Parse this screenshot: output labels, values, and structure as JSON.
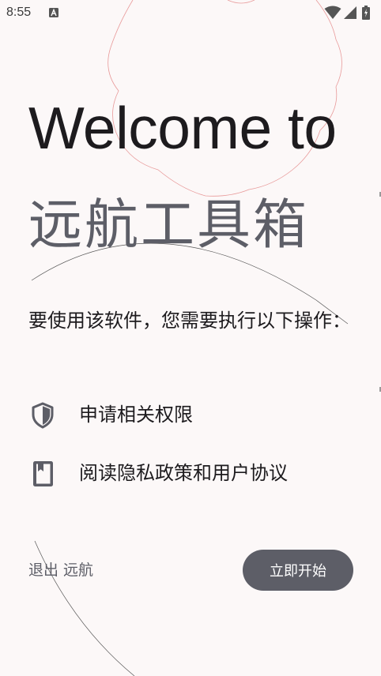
{
  "status_bar": {
    "time": "8:55",
    "app_icon": "a-badge-icon",
    "wifi_icon": "wifi-icon",
    "signal_icon": "cell-signal-icon",
    "battery_icon": "battery-charging-icon"
  },
  "welcome": {
    "title": "Welcome to",
    "app_name": "远航工具箱"
  },
  "prompt": "要使用该软件，您需要执行以下操作：",
  "requirements": [
    {
      "icon": "shield-icon",
      "label": "申请相关权限"
    },
    {
      "icon": "bookmark-book-icon",
      "label": "阅读隐私政策和用户协议"
    }
  ],
  "actions": {
    "exit_label": "退出 远航",
    "start_label": "立即开始"
  },
  "colors": {
    "background": "#fcf8f8",
    "primary": "#5d5e67",
    "text": "#1d1b1e",
    "decoration": "#e89a9a"
  }
}
